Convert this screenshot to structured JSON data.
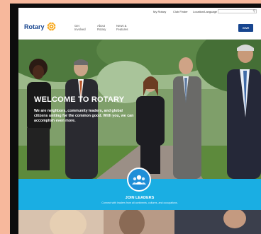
{
  "utility": {
    "my_rotary": "My Rotary",
    "club_finder": "Club Finder",
    "location_language": "Location/Language"
  },
  "header": {
    "logo": "Rotary",
    "nav": [
      {
        "line1": "Get",
        "line2": "Involved"
      },
      {
        "line1": "About",
        "line2": "Rotary"
      },
      {
        "line1": "News &",
        "line2": "Features"
      }
    ],
    "give_label": "GIVE"
  },
  "hero": {
    "title": "WELCOME TO ROTARY",
    "body": "We are neighbors, community leaders, and global citizens uniting for the common good. With you, we can accomplish even more."
  },
  "join": {
    "title": "JOIN LEADERS",
    "subtitle": "Connect with leaders from all continents, cultures, and occupations."
  },
  "colors": {
    "brand_blue": "#17458f",
    "band_cyan": "#1aaee3",
    "wheel_gold": "#f7a81b"
  }
}
